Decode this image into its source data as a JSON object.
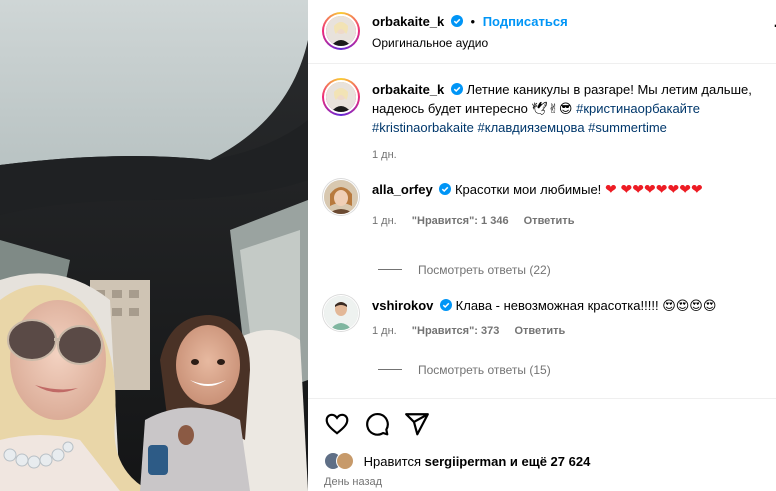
{
  "colors": {
    "accent": "#0095f6",
    "hashtag": "#00376b",
    "muted": "#737373",
    "heart": "#ed1c24"
  },
  "header": {
    "username": "orbakaite_k",
    "separator": "•",
    "follow_label": "Подписаться",
    "audio": "Оригинальное аудио",
    "more_icon": "more-horizontal-icon"
  },
  "caption": {
    "username": "orbakaite_k",
    "text": "Летние каникулы в разгаре! Мы летим дальше, надеюсь будет интересно",
    "emojis": "🕊✌😎",
    "hashtags": [
      "#кристинаорбакайте",
      "#kristinaorbakaite",
      "#клавдияземцова",
      "#summertime"
    ],
    "time": "1 дн."
  },
  "comments": [
    {
      "username": "alla_orfey",
      "text": "Красотки мои любимые!",
      "hearts": "❤ ❤❤❤❤❤❤❤",
      "time": "1 дн.",
      "likes": "\"Нравится\": 1 346",
      "reply": "Ответить",
      "view_replies": "Посмотреть ответы (22)"
    },
    {
      "username": "vshirokov",
      "text": "Клава - невозможная красотка!!!!!",
      "emojis": "😍😍😍😍",
      "time": "1 дн.",
      "likes": "\"Нравится\": 373",
      "reply": "Ответить",
      "view_replies": "Посмотреть ответы (15)"
    }
  ],
  "actions": {
    "like_icon": "heart-icon",
    "comment_icon": "comment-icon",
    "share_icon": "send-icon"
  },
  "likes": {
    "prefix": "Нравится",
    "user": "sergiiperman",
    "suffix": "и ещё 27 624"
  },
  "date": "День назад"
}
